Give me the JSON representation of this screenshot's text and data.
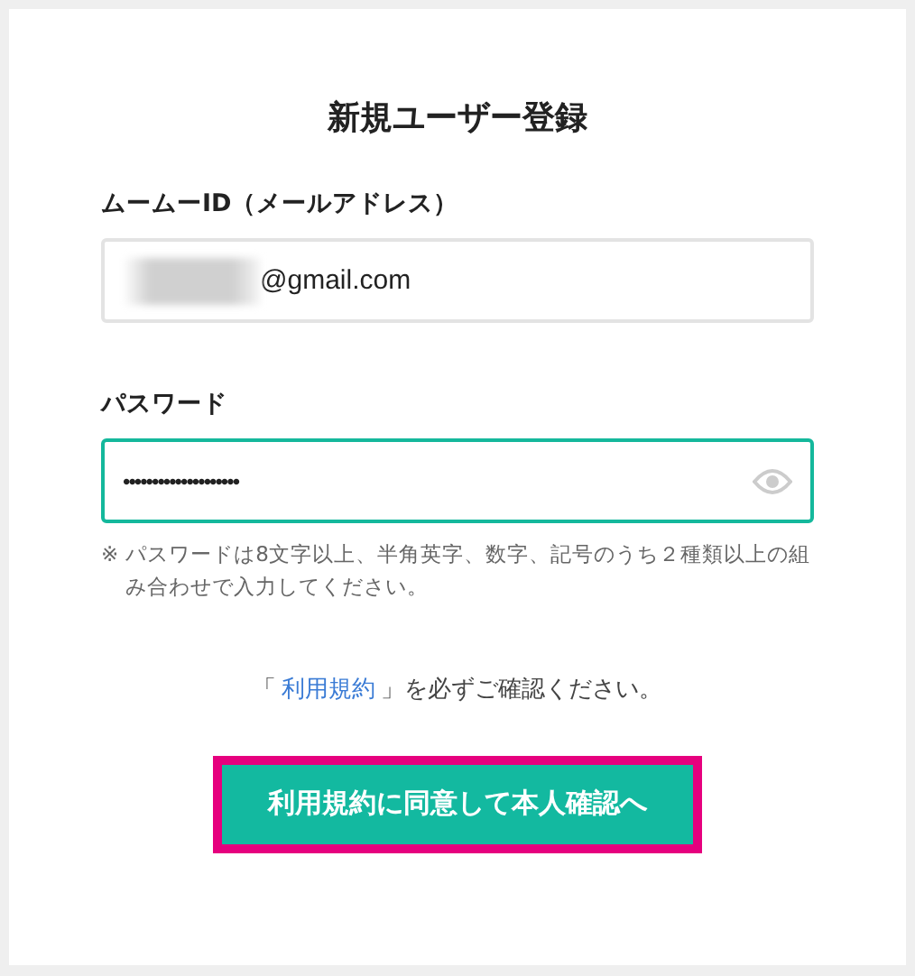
{
  "title": "新規ユーザー登録",
  "email": {
    "label": "ムームーID（メールアドレス）",
    "value": "@gmail.com",
    "redacted": true,
    "focused": false
  },
  "password": {
    "label": "パスワード",
    "value": "••••••••••••••••••••",
    "focused": true
  },
  "password_note": {
    "mark": "※",
    "text": "パスワードは8文字以上、半角英字、数字、記号のうち２種類以上の組み合わせで入力してください。"
  },
  "terms": {
    "open": "「",
    "link": "利用規約",
    "close": "」を必ずご確認ください。"
  },
  "submit_button": {
    "label": "利用規約に同意して本人確認へ",
    "highlighted": true
  }
}
